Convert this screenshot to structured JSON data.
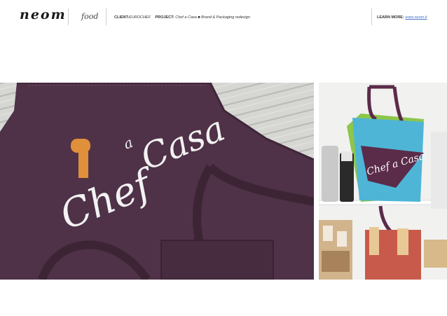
{
  "header": {
    "logo": "neom",
    "section": "food",
    "client_label": "CLIENT:",
    "client_value": "EUROCHEF",
    "project_label": "PROJECT:",
    "project_value": "Chef a Casa ■ Brand & Packaging redesign",
    "learn_label": "LEARN MORE:",
    "learn_link": "www.neom.it"
  },
  "apron_photo": {
    "brand_word_small": "a",
    "brand_word_1": "Chef",
    "brand_word_2": "Casa"
  },
  "bag_photo": {
    "brand_text": "Chef a Casa"
  },
  "colors": {
    "apron": "#4f3247",
    "wood": "#cfcfcc",
    "bag_blue": "#4eb5d6",
    "bag_red": "#c85a4c",
    "handle_purple": "#5b2b4a",
    "accent_orange": "#e0903a"
  }
}
